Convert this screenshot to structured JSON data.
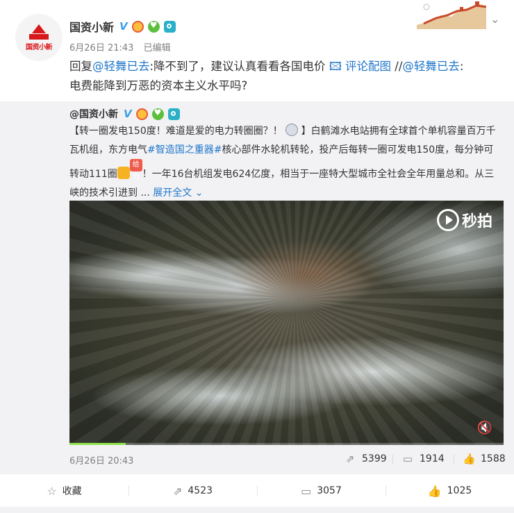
{
  "post": {
    "author": "国资小新",
    "avatar_text": "国资小新",
    "verified": "V",
    "date": "6月26日 21:43",
    "edited": "已编辑",
    "text_line1_a": "回复",
    "text_line1_mention": "@轻舞已去",
    "text_line1_b": ":降不到了，建议认真看看各国电价",
    "comment_pic": "评论配图",
    "text_line1_c": "//",
    "text_line1_mention2": "@轻舞已去",
    "text_line1_d": ":",
    "text_line2": "电费能降到万恶的资本主义水平吗?"
  },
  "repost": {
    "author": "@国资小新",
    "verified": "V",
    "text_a": "【转一圈发电150度！难道是爱的电力转圈圈？！",
    "text_b": "】白鹤滩水电站拥有全球首个单机容量百万千瓦机组，东方电气",
    "tag": "#智造国之重器#",
    "text_c": "核心部件水轮机转轮，投产后每转一圈可发电150度，每分钟可转动111圈",
    "badge": "给力",
    "text_d": "！一年16台机组发电624亿度，相当于一座特大型城市全社会全年用量总和。从三峡的技术引进到 ...",
    "expand": "展开全文",
    "video_brand": "秒拍",
    "progress": 0.13,
    "date": "6月26日 20:43",
    "shares": "5399",
    "comments": "1914",
    "likes": "1588"
  },
  "actions": {
    "favorite": "收藏",
    "share": "4523",
    "comment": "3057",
    "like": "1025"
  },
  "colors": {
    "link": "#1e76c9",
    "brand_red": "#d8191c",
    "verified_blue": "#3c9ee6",
    "progress_green": "#8fe04a"
  },
  "icons": {
    "share": "share-icon",
    "comment": "comment-icon",
    "like": "thumb-up-icon",
    "favorite": "star-icon",
    "dropdown": "chevron-down-icon"
  }
}
